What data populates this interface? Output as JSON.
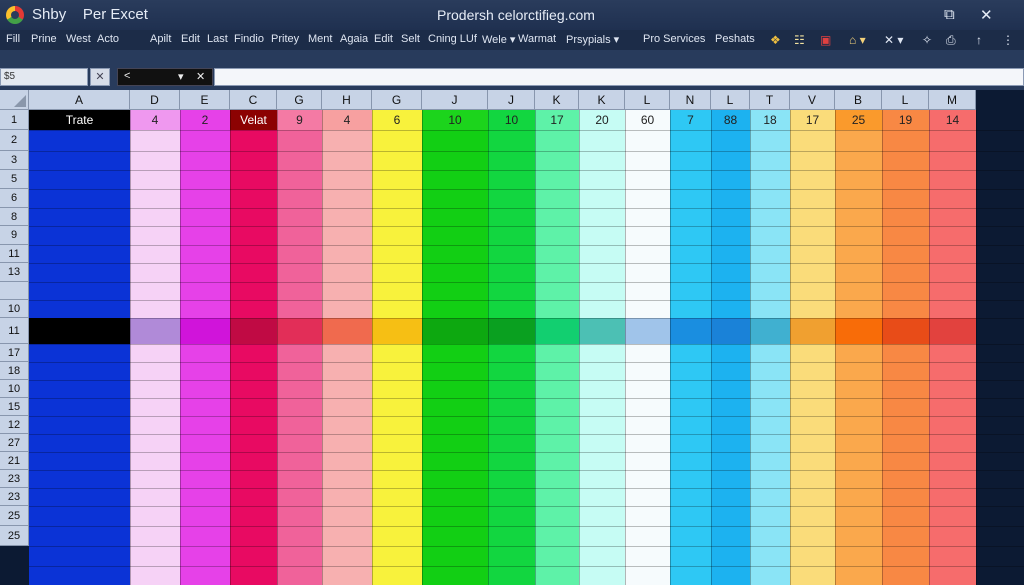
{
  "title_bar": {
    "app_name": "Shby    Per Excet",
    "window_title": "Prodersh celorctifieg.com",
    "buttons": [
      "⧉",
      "✕"
    ]
  },
  "menu": {
    "items": [
      "Fill",
      "Prine",
      "West",
      "Acto",
      "Apilt",
      "Edit",
      "Last",
      "Findio",
      "Pritey",
      "Ment",
      "Agaia",
      "Edit",
      "Selt",
      "Cning LUf",
      "Wele ▾",
      "Warmat",
      "Prsypials ▾",
      "Pro Services",
      "Peshats"
    ],
    "toolbar_icons": [
      "❖",
      "☷",
      "▣",
      "⌂ ▾",
      "✕ ▾",
      "✧",
      "⎙",
      "↑",
      "⋮"
    ]
  },
  "formula_bar": {
    "name_box": "$5",
    "name_box_button": "✕",
    "fx_left": "<",
    "fx_dropdown": "▾",
    "fx_close": "✕",
    "formula": ""
  },
  "sheet": {
    "columns": [
      {
        "letter": "A",
        "row1": "Trate",
        "fill": "#0b33d6",
        "row1_bg": "#000000",
        "row1_color": "#ffffff",
        "band": "#000000"
      },
      {
        "letter": "D",
        "row1": "4",
        "fill": "#f6d2f6",
        "row1_bg": "#ef98ef",
        "row1_color": "#222222",
        "band": "#b08ad8"
      },
      {
        "letter": "E",
        "row1": "2",
        "fill": "#e641e8",
        "row1_bg": "#e641e8",
        "row1_color": "#222222",
        "band": "#d014da"
      },
      {
        "letter": "C",
        "row1": "Velat",
        "fill": "#e80a62",
        "row1_bg": "#8c0202",
        "row1_color": "#ffffff",
        "band": "#c00a44"
      },
      {
        "letter": "G",
        "row1": "9",
        "fill": "#f0629a",
        "row1_bg": "#f47aa4",
        "row1_color": "#222222",
        "band": "#e22e58"
      },
      {
        "letter": "H",
        "row1": "4",
        "fill": "#f7b0b0",
        "row1_bg": "#f7a0a0",
        "row1_color": "#222222",
        "band": "#f06a4e"
      },
      {
        "letter": "G",
        "row1": "6",
        "fill": "#f8f23c",
        "row1_bg": "#f8f23c",
        "row1_color": "#222222",
        "band": "#f6bf14"
      },
      {
        "letter": "J",
        "row1": "10",
        "fill": "#12cf14",
        "row1_bg": "#1cd41c",
        "row1_color": "#222222",
        "band": "#0da810"
      },
      {
        "letter": "J",
        "row1": "10",
        "fill": "#12d640",
        "row1_bg": "#12d640",
        "row1_color": "#222222",
        "band": "#0aa020"
      },
      {
        "letter": "K",
        "row1": "17",
        "fill": "#5ef2a8",
        "row1_bg": "#5ef2a8",
        "row1_color": "#222222",
        "band": "#12cf70"
      },
      {
        "letter": "K",
        "row1": "20",
        "fill": "#c6fcf4",
        "row1_bg": "#c6fcf4",
        "row1_color": "#222222",
        "band": "#4cc0b4"
      },
      {
        "letter": "L",
        "row1": "60",
        "fill": "#f6fbfd",
        "row1_bg": "#f6fbfd",
        "row1_color": "#222222",
        "band": "#a0c4ea"
      },
      {
        "letter": "N",
        "row1": "7",
        "fill": "#2ec8f4",
        "row1_bg": "#2ec8f4",
        "row1_color": "#222222",
        "band": "#1a8ee0"
      },
      {
        "letter": "L",
        "row1": "88",
        "fill": "#1cb2f0",
        "row1_bg": "#1cb2f0",
        "row1_color": "#222222",
        "band": "#1a82d8"
      },
      {
        "letter": "T",
        "row1": "18",
        "fill": "#8ae4f6",
        "row1_bg": "#8ae4f6",
        "row1_color": "#222222",
        "band": "#40b0d0"
      },
      {
        "letter": "V",
        "row1": "17",
        "fill": "#fadc7a",
        "row1_bg": "#fadc7a",
        "row1_color": "#222222",
        "band": "#f0a030"
      },
      {
        "letter": "B",
        "row1": "25",
        "fill": "#faa84c",
        "row1_bg": "#fa9a2c",
        "row1_color": "#222222",
        "band": "#f86c08"
      },
      {
        "letter": "L",
        "row1": "19",
        "fill": "#f88844",
        "row1_bg": "#f88844",
        "row1_color": "#222222",
        "band": "#e84c18"
      },
      {
        "letter": "M",
        "row1": "14",
        "fill": "#f66c6c",
        "row1_bg": "#f66c6c",
        "row1_color": "#222222",
        "band": "#e2423e"
      }
    ],
    "rows": [
      "1",
      "2",
      "3",
      "5",
      "6",
      "8",
      "9",
      "11",
      "13",
      "10",
      "11",
      "17",
      "18",
      "10",
      "15",
      "12",
      "27",
      "21",
      "23",
      "23",
      "25",
      "25"
    ]
  }
}
